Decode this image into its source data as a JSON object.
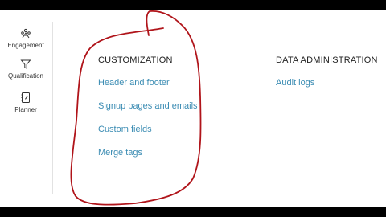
{
  "sidebar": {
    "items": [
      {
        "label": "Engagement",
        "icon": "engagement-icon"
      },
      {
        "label": "Qualification",
        "icon": "funnel-icon"
      },
      {
        "label": "Planner",
        "icon": "notebook-icon"
      }
    ]
  },
  "customization": {
    "title": "CUSTOMIZATION",
    "links": [
      "Header and footer",
      "Signup pages and emails",
      "Custom fields",
      "Merge tags"
    ]
  },
  "data_administration": {
    "title": "DATA ADMINISTRATION",
    "links": [
      "Audit logs"
    ]
  },
  "colors": {
    "link": "#3b8cb3",
    "annotation_stroke": "#b0141a",
    "letterbox": "#000000"
  }
}
